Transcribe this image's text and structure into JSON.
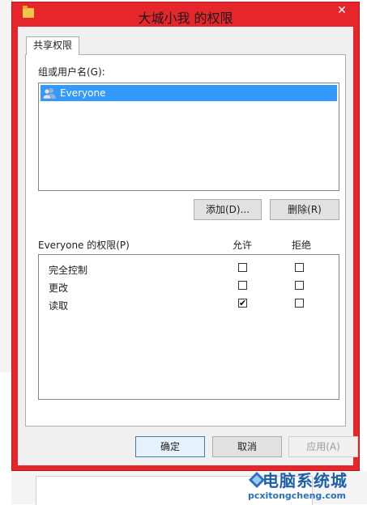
{
  "dialog": {
    "title": "大城小我 的权限",
    "close_glyph": "✕"
  },
  "tabs": [
    {
      "label": "共享权限"
    }
  ],
  "groups": {
    "label": "组或用户名(G):",
    "users": [
      {
        "name": "Everyone",
        "selected": true
      }
    ]
  },
  "buttons": {
    "add": "添加(D)...",
    "remove": "删除(R)",
    "ok": "确定",
    "cancel": "取消",
    "apply": "应用(A)"
  },
  "permissions": {
    "title": "Everyone 的权限(P)",
    "allow_header": "允许",
    "deny_header": "拒绝",
    "rows": [
      {
        "name": "完全控制",
        "allow": "",
        "deny": ""
      },
      {
        "name": "更改",
        "allow": "",
        "deny": ""
      },
      {
        "name": "读取",
        "allow": "✔",
        "deny": ""
      }
    ]
  },
  "watermark": {
    "title": "电脑系统城",
    "url": "pcxitongcheng.com"
  },
  "colors": {
    "dialog_border": "#e5262b",
    "selection": "#3399ff",
    "watermark": "#1f5fa8"
  }
}
